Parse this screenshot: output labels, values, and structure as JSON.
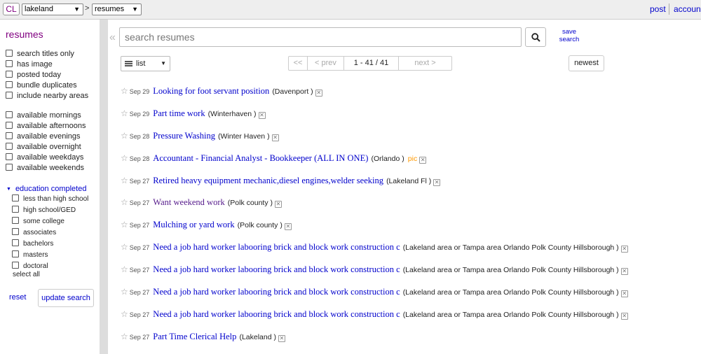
{
  "header": {
    "logo": "CL",
    "area": "lakeland",
    "separator": ">",
    "category": "resumes",
    "post": "post",
    "account": "account"
  },
  "sidebar": {
    "title": "resumes",
    "filters": [
      "search titles only",
      "has image",
      "posted today",
      "bundle duplicates",
      "include nearby areas"
    ],
    "availability": [
      "available mornings",
      "available afternoons",
      "available evenings",
      "available overnight",
      "available weekdays",
      "available weekends"
    ],
    "education_heading": "education completed",
    "education": [
      "less than high school",
      "high school/GED",
      "some college",
      "associates",
      "bachelors",
      "masters",
      "doctoral"
    ],
    "select_all": "select all",
    "reset": "reset",
    "update": "update search"
  },
  "search": {
    "placeholder": "search resumes",
    "save_label_1": "save",
    "save_label_2": "search"
  },
  "toolbar": {
    "view": "list",
    "first": "<<",
    "prev": "< prev",
    "range": "1 - 41 / 41",
    "next": "next >",
    "sort": "newest"
  },
  "results": [
    {
      "date": "Sep 29",
      "title": "Looking for foot servant position",
      "loc": "(Davenport )",
      "pic": ""
    },
    {
      "date": "Sep 29",
      "title": "Part time work",
      "loc": "(Winterhaven )",
      "pic": ""
    },
    {
      "date": "Sep 28",
      "title": "Pressure Washing",
      "loc": "(Winter Haven )",
      "pic": ""
    },
    {
      "date": "Sep 28",
      "title": "Accountant - Financial Analyst - Bookkeeper (ALL IN ONE)",
      "loc": "(Orlando )",
      "pic": "pic"
    },
    {
      "date": "Sep 27",
      "title": "Retired heavy equipment mechanic,diesel engines,welder seeking",
      "loc": "(Lakeland Fl )",
      "pic": ""
    },
    {
      "date": "Sep 27",
      "title": "Want weekend work",
      "loc": "(Polk county )",
      "pic": ""
    },
    {
      "date": "Sep 27",
      "title": "Mulching or yard work",
      "loc": "(Polk county )",
      "pic": ""
    },
    {
      "date": "Sep 27",
      "title": "Need a job hard worker labooring brick and block work construction c",
      "loc": "(Lakeland area or Tampa area Orlando Polk County Hillsborough )",
      "pic": ""
    },
    {
      "date": "Sep 27",
      "title": "Need a job hard worker labooring brick and block work construction c",
      "loc": "(Lakeland area or Tampa area Orlando Polk County Hillsborough )",
      "pic": ""
    },
    {
      "date": "Sep 27",
      "title": "Need a job hard worker labooring brick and block work construction c",
      "loc": "(Lakeland area or Tampa area Orlando Polk County Hillsborough )",
      "pic": ""
    },
    {
      "date": "Sep 27",
      "title": "Need a job hard worker labooring brick and block work construction c",
      "loc": "(Lakeland area or Tampa area Orlando Polk County Hillsborough )",
      "pic": ""
    },
    {
      "date": "Sep 27",
      "title": "Part Time Clerical Help",
      "loc": "(Lakeland )",
      "pic": ""
    }
  ],
  "colors": {
    "link": "#0000cc",
    "visited": "#551a8b",
    "pic": "#ff9900"
  }
}
